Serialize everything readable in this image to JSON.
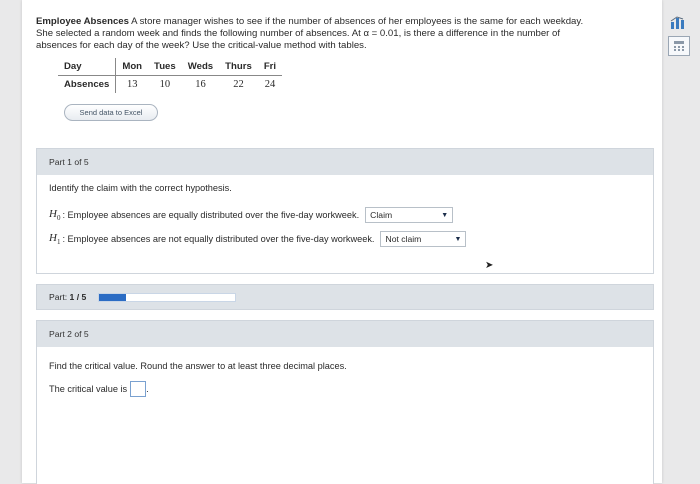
{
  "problem": {
    "title": "Employee Absences",
    "text_line1": " A store manager wishes to see if the number of absences of her employees is the same for each weekday.",
    "text_line2": "She selected a random week and finds the following number of absences. At α = 0.01, is there a difference in the number of",
    "text_line3": "absences for each day of the week? Use the critical-value method with tables."
  },
  "table": {
    "row1_label": "Day",
    "row2_label": "Absences",
    "days": [
      "Mon",
      "Tues",
      "Weds",
      "Thurs",
      "Fri"
    ],
    "absences": [
      "13",
      "10",
      "16",
      "22",
      "24"
    ]
  },
  "excel_button": "Send data to Excel",
  "part1": {
    "header": "Part 1 of 5",
    "prompt": "Identify the claim with the correct hypothesis.",
    "h0_symbol": "H",
    "h0_sub": "0",
    "h0_text": ": Employee absences are equally distributed over the five-day workweek.",
    "h0_select": "Claim",
    "h1_symbol": "H",
    "h1_sub": "1",
    "h1_text": ": Employee absences are not equally distributed over the five-day workweek.",
    "h1_select": "Not claim"
  },
  "progress": {
    "label_prefix": "Part: ",
    "label_value": "1 / 5",
    "fraction": 0.2
  },
  "part2": {
    "header": "Part 2 of 5",
    "prompt": "Find the critical value. Round the answer to at least three decimal places.",
    "answer_label": "The critical value is",
    "answer_suffix": "."
  },
  "icons": {
    "side1": "chart-icon",
    "side2": "calculator-icon"
  },
  "colors": {
    "accent": "#2b6cc4",
    "header_bg": "#dde2e7"
  }
}
